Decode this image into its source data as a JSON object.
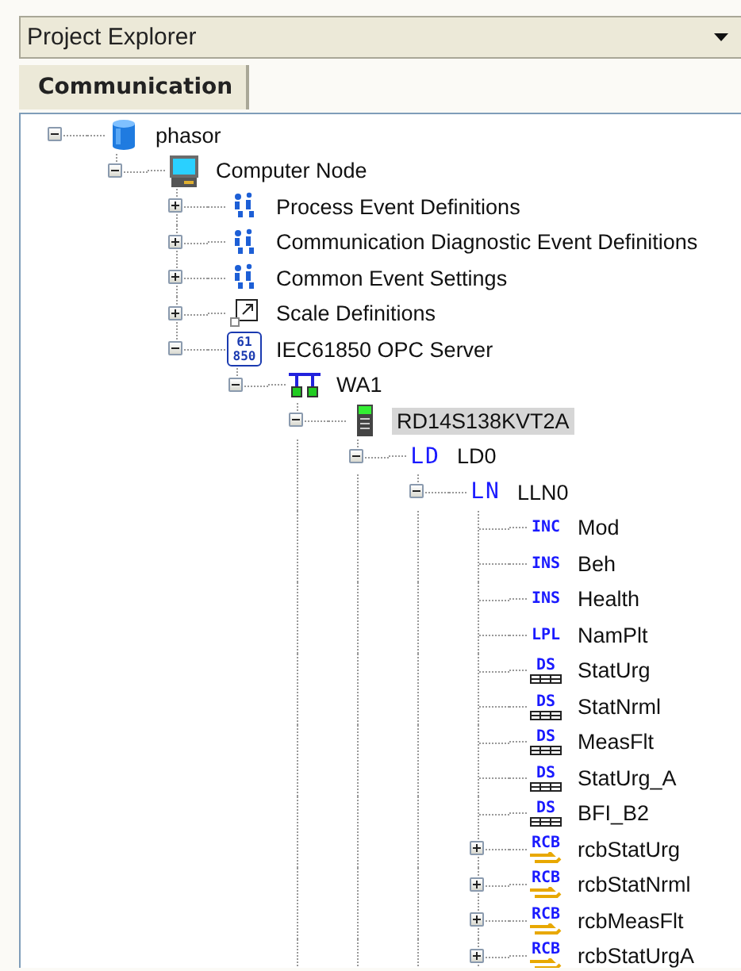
{
  "panel": {
    "title": "Project Explorer"
  },
  "tabs": [
    {
      "label": "Communication",
      "selected": true
    }
  ],
  "tree": [
    {
      "label": "phasor",
      "kind": "database",
      "expanded": true,
      "selected": false,
      "children": [
        {
          "label": "Computer Node",
          "kind": "computer",
          "expanded": true,
          "selected": false,
          "children": [
            {
              "label": "Process Event Definitions",
              "kind": "events",
              "expanded": false,
              "selected": false
            },
            {
              "label": "Communication Diagnostic Event Definitions",
              "kind": "events",
              "expanded": false,
              "selected": false
            },
            {
              "label": "Common Event Settings",
              "kind": "events",
              "expanded": false,
              "selected": false
            },
            {
              "label": "Scale Definitions",
              "kind": "scale",
              "expanded": false,
              "selected": false
            },
            {
              "label": "IEC61850 OPC Server",
              "kind": "server",
              "badge": "61 850",
              "expanded": true,
              "selected": false,
              "children": [
                {
                  "label": "WA1",
                  "kind": "network",
                  "expanded": true,
                  "selected": false,
                  "children": [
                    {
                      "label": "RD14S138KVT2A",
                      "kind": "device",
                      "expanded": true,
                      "selected": true,
                      "children": [
                        {
                          "label": "LD0",
                          "kind": "code",
                          "badge": "LD",
                          "expanded": true,
                          "selected": false,
                          "children": [
                            {
                              "label": "LLN0",
                              "kind": "code",
                              "badge": "LN",
                              "expanded": true,
                              "selected": false,
                              "children": [
                                {
                                  "label": "Mod",
                                  "kind": "small",
                                  "badge": "INC",
                                  "selected": false
                                },
                                {
                                  "label": "Beh",
                                  "kind": "small",
                                  "badge": "INS",
                                  "selected": false
                                },
                                {
                                  "label": "Health",
                                  "kind": "small",
                                  "badge": "INS",
                                  "selected": false
                                },
                                {
                                  "label": "NamPlt",
                                  "kind": "small",
                                  "badge": "LPL",
                                  "selected": false
                                },
                                {
                                  "label": "StatUrg",
                                  "kind": "dataset",
                                  "badge": "DS",
                                  "selected": false
                                },
                                {
                                  "label": "StatNrml",
                                  "kind": "dataset",
                                  "badge": "DS",
                                  "selected": false
                                },
                                {
                                  "label": "MeasFlt",
                                  "kind": "dataset",
                                  "badge": "DS",
                                  "selected": false
                                },
                                {
                                  "label": "StatUrg_A",
                                  "kind": "dataset",
                                  "badge": "DS",
                                  "selected": false
                                },
                                {
                                  "label": "BFI_B2",
                                  "kind": "dataset",
                                  "badge": "DS",
                                  "selected": false
                                },
                                {
                                  "label": "rcbStatUrg",
                                  "kind": "report",
                                  "badge": "RCB",
                                  "expanded": false,
                                  "selected": false
                                },
                                {
                                  "label": "rcbStatNrml",
                                  "kind": "report",
                                  "badge": "RCB",
                                  "expanded": false,
                                  "selected": false
                                },
                                {
                                  "label": "rcbMeasFlt",
                                  "kind": "report",
                                  "badge": "RCB",
                                  "expanded": false,
                                  "selected": false
                                },
                                {
                                  "label": "rcbStatUrgA",
                                  "kind": "report",
                                  "badge": "RCB",
                                  "expanded": false,
                                  "selected": false
                                }
                              ]
                            }
                          ]
                        }
                      ]
                    }
                  ]
                }
              ]
            }
          ]
        }
      ]
    }
  ]
}
